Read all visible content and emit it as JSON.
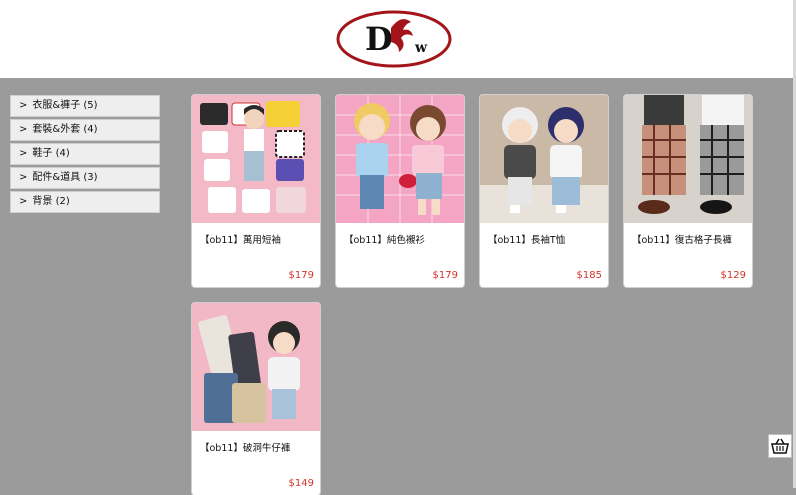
{
  "header": {
    "logo_text": "Dw"
  },
  "sidebar": {
    "arrow": ">",
    "items": [
      {
        "label": "衣服&褲子 (5)"
      },
      {
        "label": "套裝&外套 (4)"
      },
      {
        "label": "鞋子 (4)"
      },
      {
        "label": "配件&道具 (3)"
      },
      {
        "label": "背景 (2)"
      }
    ]
  },
  "products": [
    {
      "title": "【ob11】萬用短袖",
      "price": "$179",
      "image_icon": "tshirt-collection-photo"
    },
    {
      "title": "【ob11】純色襯衫",
      "price": "$179",
      "image_icon": "doll-couple-shirts-photo"
    },
    {
      "title": "【ob11】長袖T恤",
      "price": "$185",
      "image_icon": "doll-longsleeve-photo"
    },
    {
      "title": "【ob11】復古格子長褲",
      "price": "$129",
      "image_icon": "plaid-pants-photo"
    },
    {
      "title": "【ob11】破洞牛仔褲",
      "price": "$149",
      "image_icon": "ripped-jeans-photo"
    }
  ],
  "colors": {
    "background": "#9b9b9b",
    "price": "#d0342c",
    "logo_red": "#a3151b"
  },
  "cart": {
    "icon": "shopping-basket-icon"
  }
}
